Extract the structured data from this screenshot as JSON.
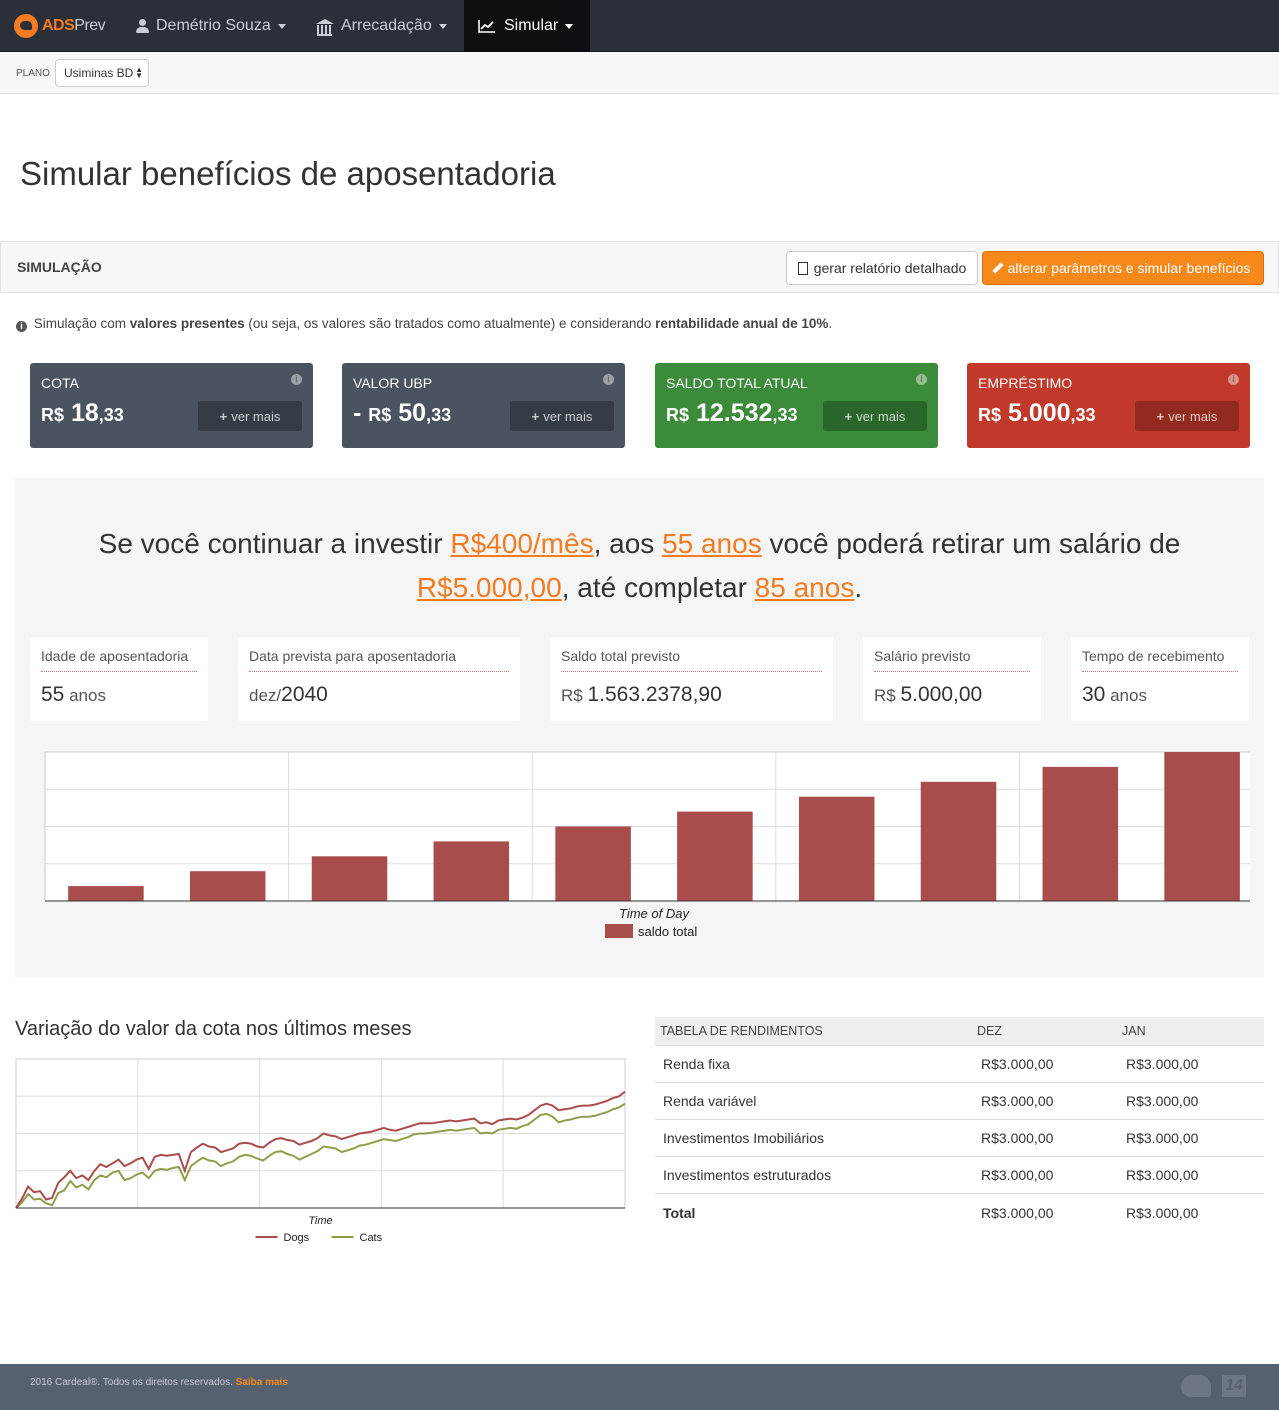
{
  "nav": {
    "brand_strong": "ADS",
    "brand_rest": "Prev",
    "user": "Demétrio Souza",
    "arrecadacao": "Arrecadação",
    "simular": "Simular"
  },
  "subbar": {
    "plano_label": "PLANO",
    "plano_value": "Usiminas BD"
  },
  "page_title": "Simular benefícios de aposentadoria",
  "panel": {
    "title": "SIMULAÇÃO",
    "report_button": "gerar relatório detalhado",
    "simulate_button": "alterar parâmetros e simular benefícios"
  },
  "info": {
    "p1": " Simulação com ",
    "b1": "valores presentes",
    "p2": " (ou seja, os valores são tratados como atualmente) e considerando ",
    "b2": "rentabilidade anual de 10%",
    "p3": "."
  },
  "cards": [
    {
      "label": "COTA",
      "sign": "",
      "currency": "R$",
      "int": "18",
      "dec": ",33",
      "more": "ver mais",
      "color": "#4a5360",
      "btn": "#353c46"
    },
    {
      "label": "VALOR UBP",
      "sign": "- ",
      "currency": "R$",
      "int": "50",
      "dec": ",33",
      "more": "ver mais",
      "color": "#4a5360",
      "btn": "#353c46"
    },
    {
      "label": "SALDO TOTAL ATUAL",
      "sign": "",
      "currency": "R$",
      "int": "12.532",
      "dec": ",33",
      "more": "ver mais",
      "color": "#3c8b3a",
      "btn": "#2a6529"
    },
    {
      "label": "EMPRÉSTIMO",
      "sign": "",
      "currency": "R$",
      "int": "5.000",
      "dec": ",33",
      "more": "ver mais",
      "color": "#c0392b",
      "btn": "#922a1f"
    }
  ],
  "projection": {
    "t1": "Se você continuar a investir ",
    "l1": "R$400/mês",
    "t2": ", aos ",
    "l2": "55 anos",
    "t3": " você poderá retirar um salário de",
    "l3": "R$5.000,00",
    "t4": ", até completar ",
    "l4": "85 anos",
    "t5": "."
  },
  "summary": [
    {
      "label": "Idade de aposentadoria",
      "prefix": "",
      "value": "55",
      "suffix": " anos"
    },
    {
      "label": "Data prevista para aposentadoria",
      "prefix": "dez/",
      "value": "2040",
      "suffix": ""
    },
    {
      "label": "Saldo total previsto",
      "prefix": "R$ ",
      "value": "1.563.2378,90",
      "suffix": ""
    },
    {
      "label": "Salário previsto",
      "prefix": "R$ ",
      "value": "5.000,00",
      "suffix": ""
    },
    {
      "label": "Tempo de recebimento",
      "prefix": "",
      "value": "30",
      "suffix": " anos"
    }
  ],
  "chart_data": [
    {
      "type": "bar",
      "xlabel": "Time of Day",
      "ylabel": "",
      "legend": "bottom",
      "series": [
        {
          "name": "saldo total",
          "color": "#a94c4c",
          "values": [
            1,
            2,
            3,
            4,
            5,
            6,
            7,
            8,
            9,
            10
          ]
        }
      ],
      "ylim": [
        0,
        10
      ],
      "grid": true
    },
    {
      "type": "line",
      "title": "Variação do valor da cota nos últimos meses",
      "xlabel": "Time",
      "ylabel": "",
      "legend": "bottom",
      "series": [
        {
          "name": "Dogs",
          "color": "#a94c4c",
          "values": [
            0,
            10,
            23,
            17,
            18,
            9,
            11,
            27,
            33,
            40,
            32,
            35,
            30,
            40,
            47,
            44,
            48,
            52,
            45,
            48,
            52,
            54,
            42,
            55,
            57,
            56,
            57,
            58,
            40,
            60,
            65,
            69,
            66,
            65,
            60,
            62,
            64,
            69,
            70,
            69,
            66,
            65,
            70,
            74,
            75,
            73,
            72,
            68,
            70,
            72,
            75,
            80,
            78,
            77,
            74,
            76,
            78,
            80,
            81,
            82,
            84,
            86,
            84,
            83,
            85,
            87,
            89,
            91,
            91,
            91,
            92,
            93,
            94,
            93,
            94,
            95,
            96,
            91,
            92,
            90,
            94,
            95,
            96,
            95,
            97,
            100,
            105,
            110,
            112,
            110,
            105,
            106,
            107,
            109,
            110,
            110,
            111,
            113,
            115,
            118,
            120,
            125
          ]
        },
        {
          "name": "Cats",
          "color": "#8f9e4a",
          "values": [
            0,
            6,
            15,
            9,
            10,
            5,
            3,
            16,
            19,
            29,
            22,
            25,
            20,
            30,
            35,
            33,
            38,
            40,
            30,
            32,
            36,
            38,
            32,
            40,
            42,
            41,
            43,
            44,
            30,
            45,
            50,
            54,
            51,
            50,
            45,
            48,
            50,
            55,
            57,
            56,
            53,
            51,
            56,
            60,
            61,
            58,
            56,
            52,
            55,
            58,
            61,
            66,
            65,
            64,
            60,
            62,
            64,
            67,
            68,
            70,
            72,
            74,
            73,
            72,
            74,
            76,
            79,
            80,
            80,
            81,
            82,
            83,
            84,
            83,
            84,
            85,
            86,
            80,
            81,
            80,
            84,
            85,
            86,
            85,
            88,
            90,
            95,
            100,
            101,
            98,
            92,
            94,
            95,
            97,
            98,
            98,
            99,
            101,
            103,
            106,
            108,
            112
          ]
        }
      ],
      "ylim": [
        0,
        160
      ],
      "grid": true
    }
  ],
  "table": {
    "headers": [
      "TABELA DE RENDIMENTOS",
      "DEZ",
      "JAN"
    ],
    "rows": [
      [
        "Renda fixa",
        "R$3.000,00",
        "R$3.000,00"
      ],
      [
        "Renda variável",
        "R$3.000,00",
        "R$3.000,00"
      ],
      [
        "Investimentos Imobiliários",
        "R$3.000,00",
        "R$3.000,00"
      ],
      [
        "Investimentos estruturados",
        "R$3.000,00",
        "R$3.000,00"
      ],
      [
        "Total",
        "R$3.000,00",
        "R$3.000,00"
      ]
    ]
  },
  "footer": {
    "text": "2016 Cardeal®. Todos os direitos reservados. ",
    "link": "Saiba mais",
    "badge": "14"
  },
  "colors": {
    "accent": "#f47b20",
    "navbar": "#2b2f38",
    "footer": "#566170"
  }
}
